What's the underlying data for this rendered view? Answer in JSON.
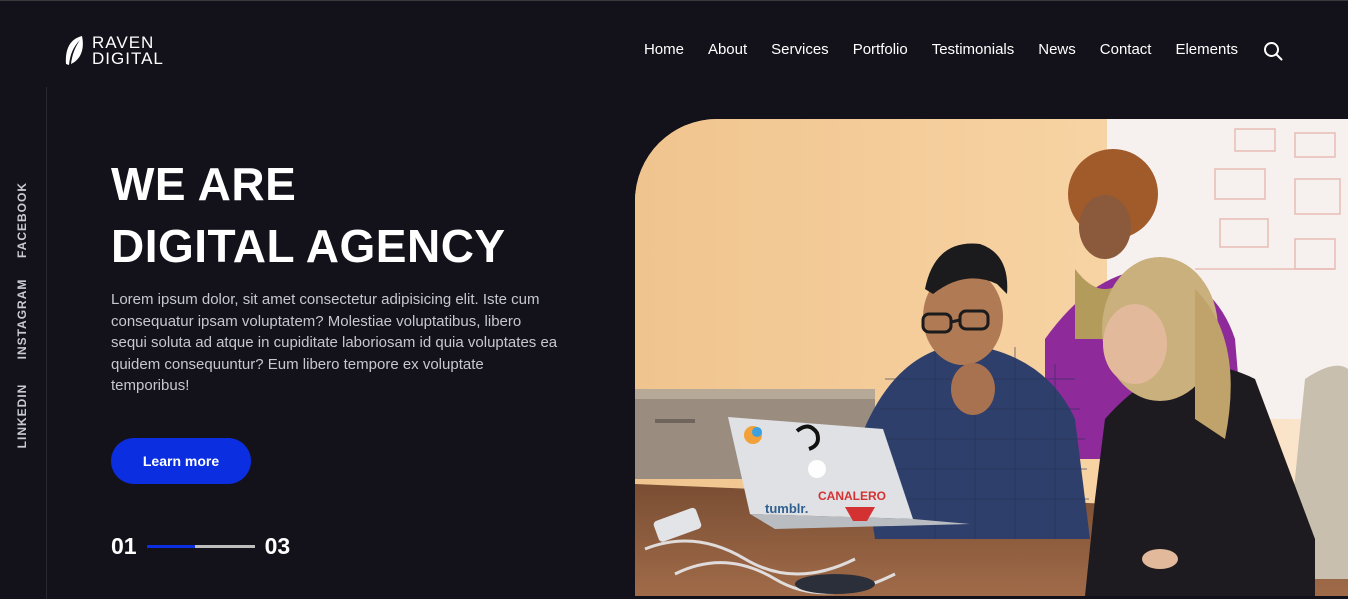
{
  "brand": {
    "line1": "RAVEN",
    "line2": "DIGITAL"
  },
  "nav": {
    "items": [
      "Home",
      "About",
      "Services",
      "Portfolio",
      "Testimonials",
      "News",
      "Contact",
      "Elements"
    ]
  },
  "search": {
    "icon": "search-icon"
  },
  "social": {
    "items": [
      "FACEBOOK",
      "INSTAGRAM",
      "LINKEDIN"
    ]
  },
  "hero": {
    "title_line1": "WE ARE",
    "title_line2": "DIGITAL AGENCY",
    "description": "Lorem ipsum dolor, sit amet consectetur adipisicing elit. Iste cum consequatur ipsam voluptatem? Molestiae voluptatibus, libero sequi soluta ad atque in cupiditate laboriosam id quia voluptates ea quidem consequuntur? Eum libero tempore ex voluptate temporibus!",
    "cta_label": "Learn more"
  },
  "slider": {
    "current": "01",
    "total": "03",
    "progress": 0.45
  },
  "photo": {
    "stickers": [
      "tumblr.",
      "CANALERO"
    ]
  },
  "colors": {
    "background": "#13121a",
    "accent": "#0b2fe0"
  }
}
